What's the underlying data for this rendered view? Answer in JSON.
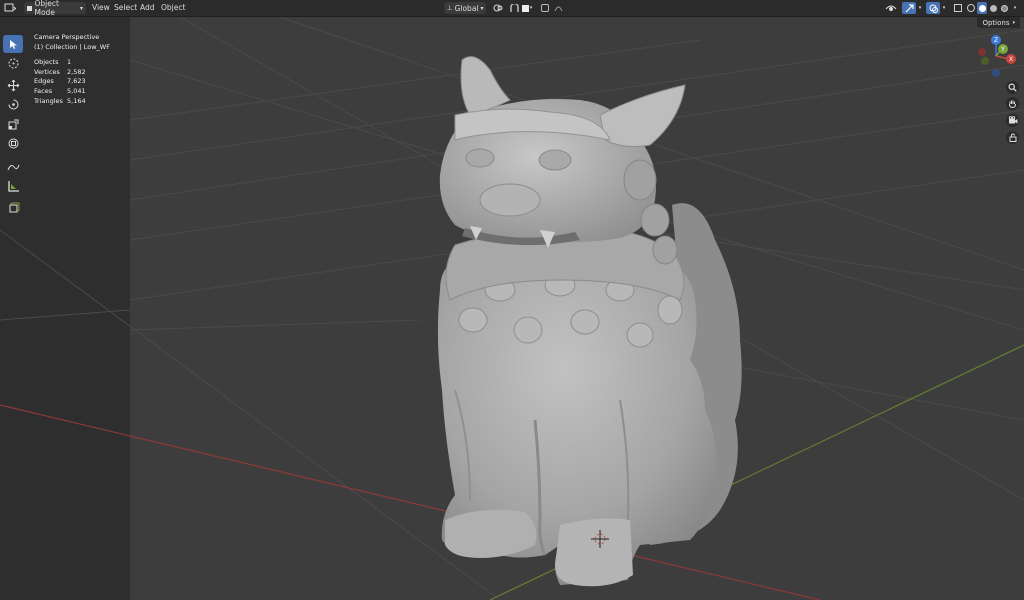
{
  "header": {
    "mode_label": "Object Mode",
    "menus": [
      "View",
      "Select",
      "Add",
      "Object"
    ],
    "transform_orientation": "Global"
  },
  "overlay": {
    "view_name": "Camera Perspective",
    "collection": "(1) Collection | Low_WF",
    "stats": [
      {
        "label": "Objects",
        "value": "1"
      },
      {
        "label": "Vertices",
        "value": "2,582"
      },
      {
        "label": "Edges",
        "value": "7,623"
      },
      {
        "label": "Faces",
        "value": "5,041"
      },
      {
        "label": "Triangles",
        "value": "5,164"
      }
    ]
  },
  "options_label": "Options",
  "gizmo": {
    "x": "X",
    "y": "Y",
    "z": "Z"
  },
  "colors": {
    "header_bg": "#2b2b2b",
    "viewport_bg": "#3d3d3d",
    "active_tool": "#4772b3",
    "x_axis": "#c8463f",
    "y_axis": "#7aa23a",
    "z_axis": "#3c7bd6",
    "model": "#a8a8a8"
  }
}
